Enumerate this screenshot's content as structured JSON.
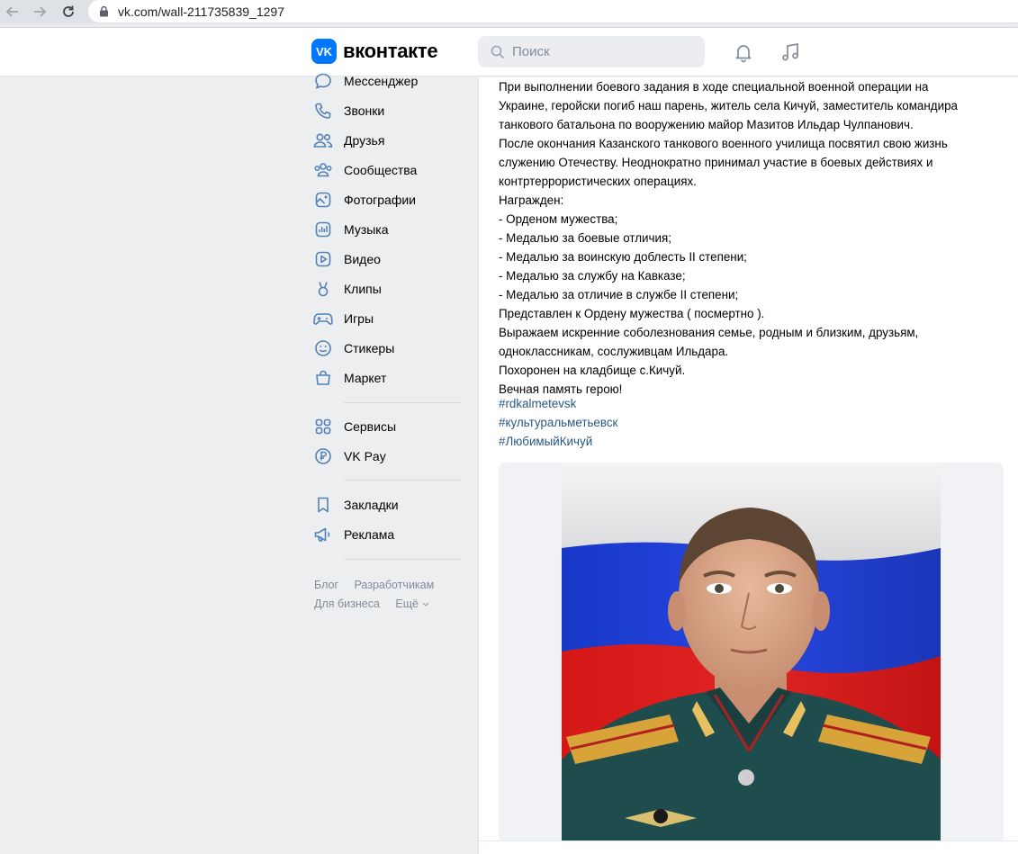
{
  "browser": {
    "url": "vk.com/wall-211735839_1297"
  },
  "header": {
    "logo_mark": "VK",
    "logo_text": "вконтакте",
    "search_placeholder": "Поиск"
  },
  "sidebar": {
    "items": [
      {
        "label": "Мессенджер",
        "icon": "messenger-icon"
      },
      {
        "label": "Звонки",
        "icon": "phone-icon"
      },
      {
        "label": "Друзья",
        "icon": "friends-icon"
      },
      {
        "label": "Сообщества",
        "icon": "communities-icon"
      },
      {
        "label": "Фотографии",
        "icon": "photos-icon"
      },
      {
        "label": "Музыка",
        "icon": "music-icon"
      },
      {
        "label": "Видео",
        "icon": "video-icon"
      },
      {
        "label": "Клипы",
        "icon": "clips-icon"
      },
      {
        "label": "Игры",
        "icon": "games-icon"
      },
      {
        "label": "Стикеры",
        "icon": "stickers-icon"
      },
      {
        "label": "Маркет",
        "icon": "market-icon"
      }
    ],
    "items2": [
      {
        "label": "Сервисы",
        "icon": "services-icon"
      },
      {
        "label": "VK Pay",
        "icon": "vkpay-icon"
      }
    ],
    "items3": [
      {
        "label": "Закладки",
        "icon": "bookmark-icon"
      },
      {
        "label": "Реклама",
        "icon": "ads-icon"
      }
    ],
    "footer": {
      "blog": "Блог",
      "developers": "Разработчикам",
      "business": "Для бизнеса",
      "more": "Ещё"
    }
  },
  "post": {
    "lines": [
      "При выполнении боевого задания в ходе специальной военной операции на",
      "Украине, геройски погиб наш парень, житель села Кичуй, заместитель командира",
      "танкового батальона по вооружению майор Мазитов Ильдар Чулпанович.",
      "После окончания Казанского танкового военного училища посвятил свою жизнь",
      "служению Отечеству. Неоднократно принимал участие в боевых действиях и",
      "контртеррористических операциях.",
      "Награжден:",
      "- Орденом мужества;",
      "- Медалью за боевые отличия;",
      "- Медалью за воинскую доблесть II степени;",
      "- Медалью за службу на Кавказе;",
      "- Медалью за отличие в службе II степени;",
      "Представлен к Ордену мужества ( посмертно ).",
      "Выражаем искренние соболезнования семье, родным и близким, друзьям,",
      "одноклассникам, сослуживцам Ильдара.",
      "Похоронен на кладбище с.Кичуй.",
      "Вечная память герою!"
    ],
    "hashtags": [
      "#rdkalmetevsk",
      "#культуральметьевск",
      "#ЛюбимыйКичуй"
    ]
  },
  "colors": {
    "accent": "#0077ff",
    "link": "#2a5885",
    "bg": "#edeef0"
  }
}
